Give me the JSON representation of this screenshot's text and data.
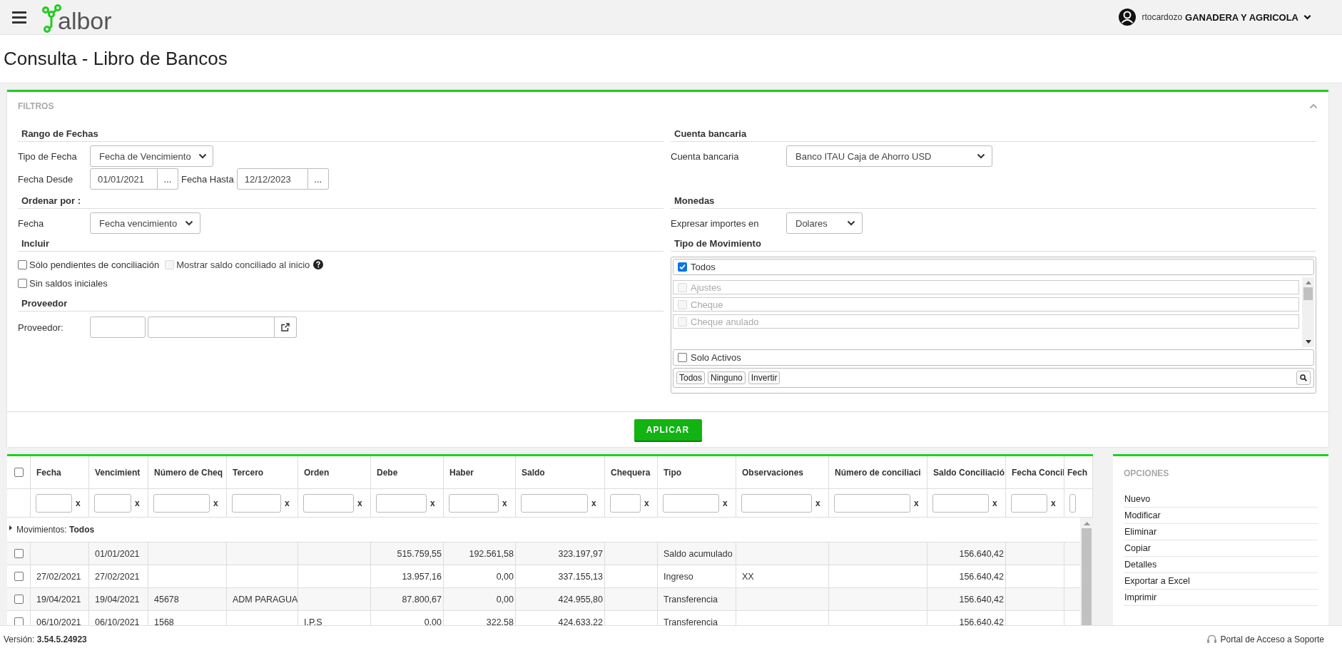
{
  "header": {
    "logo": "albor",
    "user": "rtocardozo",
    "company": "GANADERA Y AGRICOLA"
  },
  "page_title": "Consulta - Libro de Bancos",
  "filters": {
    "title": "FILTROS",
    "rango_fechas": {
      "heading": "Rango de Fechas",
      "tipo_label": "Tipo de Fecha",
      "tipo_value": "Fecha de Vencimiento",
      "desde_label": "Fecha Desde",
      "desde_value": "01/01/2021",
      "desde_button": "...",
      "hasta_label": "Fecha Hasta",
      "hasta_value": "12/12/2023",
      "hasta_button": "..."
    },
    "ordenar": {
      "heading": "Ordenar por :",
      "label": "Fecha",
      "value": "Fecha vencimiento"
    },
    "incluir": {
      "heading": "Incluir",
      "lines": [
        {
          "options": [
            {
              "label": "Sólo pendientes de conciliación",
              "checked": false,
              "disabled": false,
              "help": false
            },
            {
              "label": "Mostrar saldo conciliado al inicio",
              "checked": false,
              "disabled": true,
              "help": true
            }
          ]
        },
        {
          "options": [
            {
              "label": "Sin saldos iniciales",
              "checked": false,
              "disabled": false,
              "help": false
            }
          ]
        }
      ]
    },
    "proveedor": {
      "heading": "Proveedor",
      "label": "Proveedor:"
    },
    "cuenta": {
      "heading": "Cuenta bancaria",
      "label": "Cuenta bancaria",
      "value": "Banco ITAU Caja de Ahorro USD"
    },
    "monedas": {
      "heading": "Monedas",
      "label": "Expresar importes en",
      "value": "Dolares"
    },
    "tipo_movimiento": {
      "heading": "Tipo de Movimiento",
      "all": {
        "label": "Todos",
        "checked": true
      },
      "items": [
        {
          "label": "Ajustes",
          "checked": false,
          "disabled": true
        },
        {
          "label": "Cheque",
          "checked": false,
          "disabled": true
        },
        {
          "label": "Cheque anulado",
          "checked": false,
          "disabled": true
        }
      ],
      "solo_activos": {
        "label": "Solo Activos",
        "checked": false
      },
      "buttons": [
        "Todos",
        "Ninguno",
        "Invertir"
      ]
    },
    "apply_button": "APLICAR"
  },
  "table": {
    "select_all_checked": false,
    "columns": [
      {
        "label": "Fecha",
        "kind": "text",
        "clear": "x"
      },
      {
        "label": "Vencimient",
        "kind": "text",
        "clear": "x"
      },
      {
        "label": "Número de Cheq",
        "kind": "text",
        "clear": "x"
      },
      {
        "label": "Tercero",
        "kind": "text",
        "clear": "x"
      },
      {
        "label": "Orden",
        "kind": "text",
        "clear": "x"
      },
      {
        "label": "Debe",
        "kind": "number",
        "clear": "x"
      },
      {
        "label": "Haber",
        "kind": "number",
        "clear": "x"
      },
      {
        "label": "Saldo",
        "kind": "number",
        "clear": "x"
      },
      {
        "label": "Chequera",
        "kind": "text",
        "clear": "x"
      },
      {
        "label": "Tipo",
        "kind": "text",
        "clear": "x"
      },
      {
        "label": "Observaciones",
        "kind": "text",
        "clear": "x"
      },
      {
        "label": "Número de conciliaci",
        "kind": "text",
        "clear": "x"
      },
      {
        "label": "Saldo Conciliació",
        "kind": "number",
        "clear": "x"
      },
      {
        "label": "Fecha Concil",
        "kind": "text",
        "clear": "x"
      },
      {
        "label": "Fech",
        "kind": "text"
      }
    ],
    "group": "Movimientos: **Todos**",
    "rows": [
      {
        "checked": false,
        "vencimiento": "01/01/2021",
        "debe": "515.759,55",
        "haber": "192.561,58",
        "saldo": "323.197,97",
        "tipo": "Saldo acumulado",
        "saldo_conciliacion": "156.640,42"
      },
      {
        "checked": false,
        "fecha": "27/02/2021",
        "vencimiento": "27/02/2021",
        "debe": "13.957,16",
        "haber": "0,00",
        "saldo": "337.155,13",
        "tipo": "Ingreso",
        "observaciones": "XX",
        "saldo_conciliacion": "156.640,42"
      },
      {
        "checked": false,
        "fecha": "19/04/2021",
        "vencimiento": "19/04/2021",
        "numero_cheque": "45678",
        "tercero": "ADM PARAGUA",
        "debe": "87.800,67",
        "haber": "0,00",
        "saldo": "424.955,80",
        "tipo": "Transferencia",
        "saldo_conciliacion": "156.640,42"
      },
      {
        "checked": false,
        "fecha": "06/10/2021",
        "vencimiento": "06/10/2021",
        "numero_cheque": "1568",
        "orden": "I.P.S",
        "debe": "0,00",
        "haber": "322,58",
        "saldo": "424.633,22",
        "tipo": "Transferencia",
        "saldo_conciliacion": "156.640,42"
      }
    ]
  },
  "options": {
    "title": "OPCIONES",
    "items": [
      "Nuevo",
      "Modificar",
      "Eliminar",
      "Copiar",
      "Detalles",
      "Exportar a Excel",
      "Imprimir"
    ]
  },
  "footer": {
    "version": "Versión: **3.54.5.24923**",
    "support": "Portal de Acceso a Soporte"
  }
}
